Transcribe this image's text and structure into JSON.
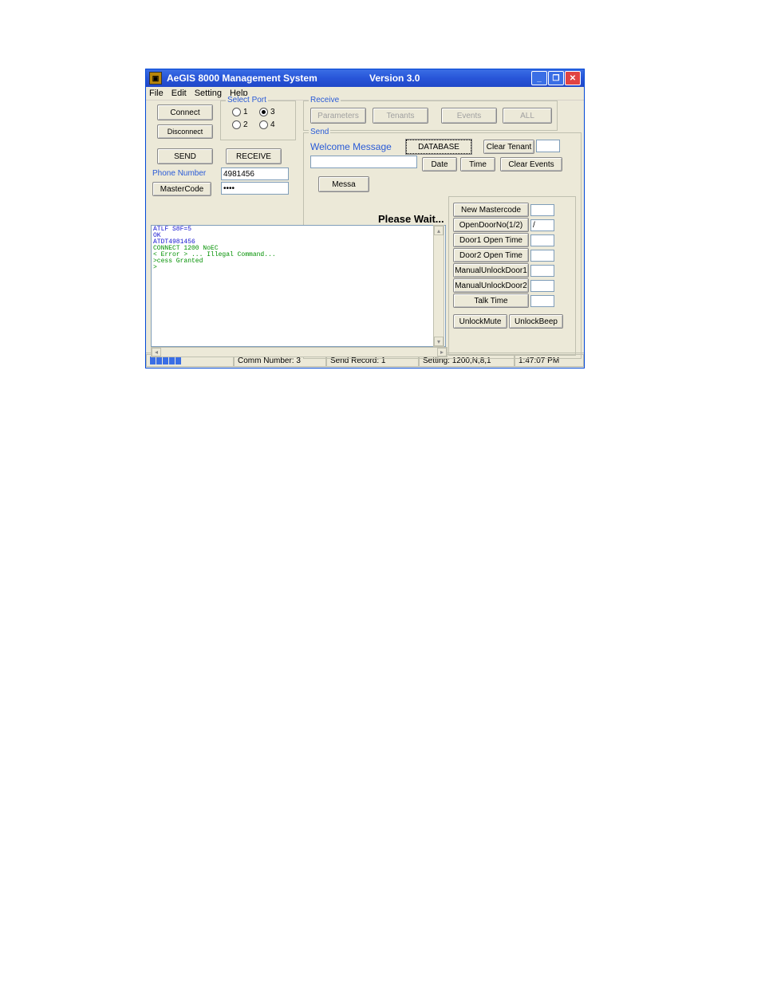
{
  "titlebar": {
    "app_name": "AeGIS 8000 Management System",
    "version": "Version 3.0"
  },
  "menu": {
    "file": "File",
    "edit": "Edit",
    "setting": "Setting",
    "help": "Help"
  },
  "connect": {
    "connect": "Connect",
    "disconnect": "Disconnect",
    "select_port": "Select Port",
    "p1": "1",
    "p2": "2",
    "p3": "3",
    "p4": "4",
    "send": "SEND",
    "receive": "RECEIVE",
    "phone_label": "Phone Number",
    "phone_value": "4981456",
    "mastercode_label": "MasterCode",
    "mastercode_value": "••••"
  },
  "receive": {
    "label": "Receive",
    "parameters": "Parameters",
    "tenants": "Tenants",
    "events": "Events",
    "all": "ALL"
  },
  "send_group": {
    "label": "Send",
    "welcome": "Welcome Message",
    "database": "DATABASE",
    "clear_tenant": "Clear Tenant",
    "date": "Date",
    "time": "Time",
    "clear_events": "Clear Events",
    "message": "Messa"
  },
  "please_wait": "Please Wait...",
  "console_lines": [
    "ATLF S8F=5",
    "OK",
    "ATDT4981456",
    "CONNECT 1200 NoEC",
    "< Error > ... Illegal Command...",
    ">cess Granted",
    ">"
  ],
  "side": {
    "new_mastercode": "New Mastercode",
    "open_door": "OpenDoorNo(1/2)",
    "open_door_val": "/",
    "door1": "Door1 Open Time",
    "door2": "Door2 Open Time",
    "manual1": "ManualUnlockDoor1",
    "manual2": "ManualUnlockDoor2",
    "talk": "Talk Time",
    "unlock_mute": "UnlockMute",
    "unlock_beep": "UnlockBeep"
  },
  "status": {
    "comm": "Comm Number:  3",
    "send_record": "Send Record:  1",
    "setting": "Setting: 1200,N,8,1",
    "time": "1:47:07 PM"
  }
}
